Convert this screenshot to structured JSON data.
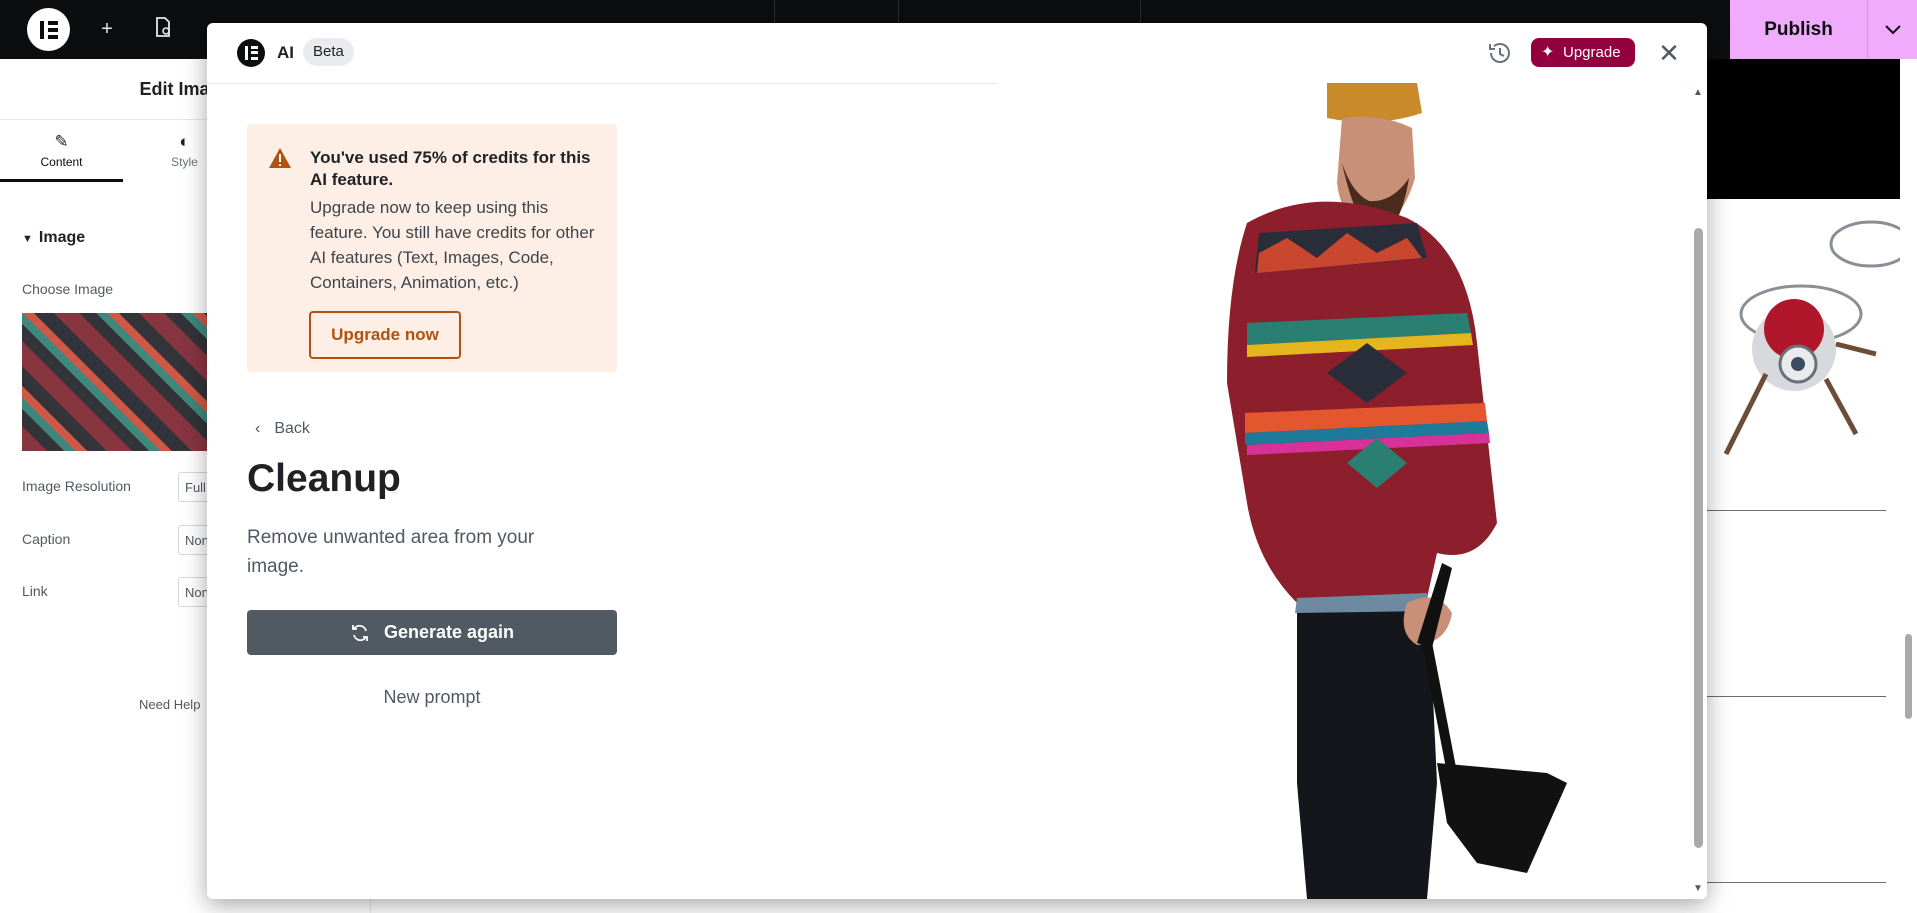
{
  "topbar": {
    "icons": [
      "elementor-logo-icon",
      "plus-icon",
      "page-settings-icon",
      "more-icon",
      "navigator-icon",
      "desktop-icon",
      "tablet-icon",
      "mobile-icon",
      "notes-icon",
      "whats-new-icon",
      "help-icon",
      "preview-icon",
      "user-avatar-icon"
    ],
    "publish_label": "Publish"
  },
  "editor_panel": {
    "title": "Edit Image",
    "tabs": [
      {
        "label": "Content",
        "icon": "pencil-icon",
        "active": true
      },
      {
        "label": "Style",
        "icon": "half-circle-icon",
        "active": false
      }
    ],
    "section_title": "Image",
    "choose_image_label": "Choose Image",
    "fields": [
      {
        "label": "Image Resolution",
        "value": "Full"
      },
      {
        "label": "Caption",
        "value": "None"
      },
      {
        "label": "Link",
        "value": "None"
      }
    ],
    "help_text": "Need Help"
  },
  "ai_modal": {
    "title": "AI",
    "badge": "Beta",
    "upgrade_label": "Upgrade",
    "alert": {
      "title": "You've used 75% of credits for this AI feature.",
      "body": "Upgrade now to keep using this feature. You still have credits for other AI features (Text, Images, Code, Containers, Animation, etc.)",
      "button": "Upgrade now"
    },
    "back_label": "Back",
    "heading": "Cleanup",
    "description": "Remove unwanted area from your image.",
    "generate_label": "Generate again",
    "new_prompt_label": "New prompt"
  },
  "colors": {
    "topbar_bg": "#0c0d0e",
    "publish_bg": "#f0abfc",
    "upgrade_bg": "#93003f",
    "alert_bg": "#fdefe6",
    "alert_accent": "#b15211",
    "generate_bg": "#515962"
  }
}
